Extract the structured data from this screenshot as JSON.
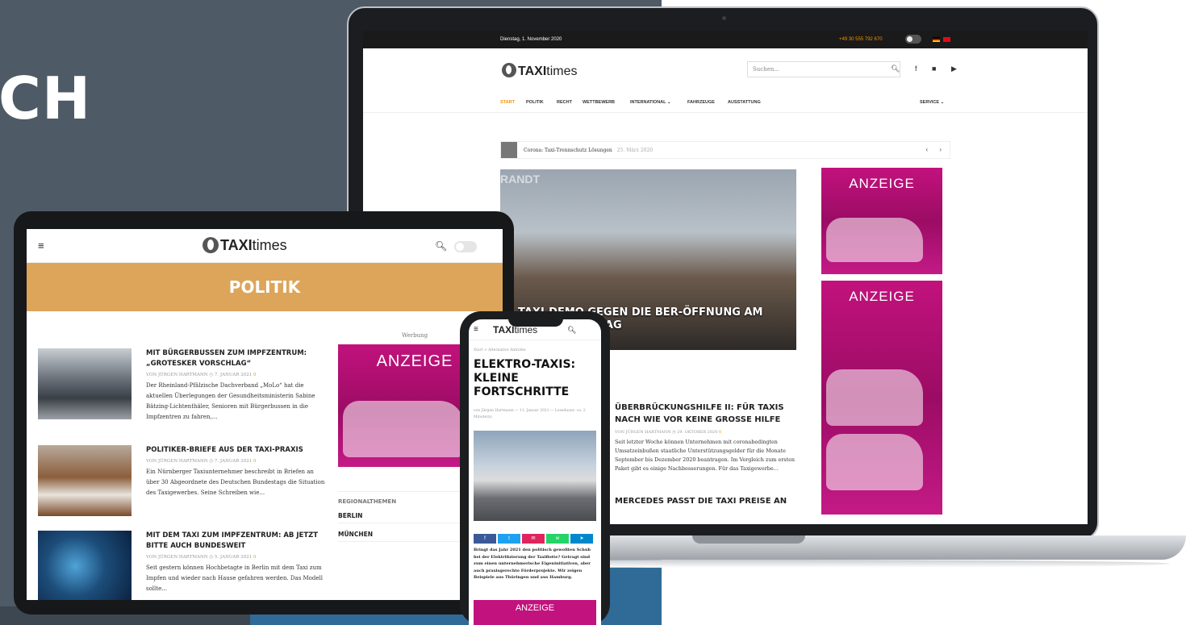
{
  "hero_headline": "CH",
  "laptop": {
    "topbar": {
      "date": "Dienstag, 1. November 2020",
      "phone": "+49 30 555 792 670"
    },
    "logo": {
      "strong": "TAXI",
      "rest": "times"
    },
    "search_placeholder": "Suchen...",
    "social_icons": "f ■ ▶",
    "nav": [
      {
        "label": "START",
        "active": true
      },
      {
        "label": "POLITIK"
      },
      {
        "label": "RECHT"
      },
      {
        "label": "WETTBEWERB"
      },
      {
        "label": "INTERNATIONAL ⌄"
      },
      {
        "label": "FAHRZEUGE"
      },
      {
        "label": "AUSSTATTUNG"
      },
      {
        "label": "SERVICE ⌄"
      }
    ],
    "ticker": {
      "text": "Corona: Taxi-Trennschutz Lösungen",
      "date": "25. März 2020"
    },
    "hero": {
      "label": "RANDT",
      "title": "TAXI-DEMO GEGEN DIE BER-ÖFFNUNG AM ERÖFFNUNGSTAG"
    },
    "ads": [
      "ANZEIGE",
      "ANZEIGE"
    ],
    "article1": {
      "title": "ÜBERBRÜCKUNGSHILFE II: FÜR TAXIS NACH WIE VOR KEINE GROSSE HILFE",
      "meta": "VON JÜRGEN HARTMANN  ◷ 29. OKTOBER 2020",
      "comments": "0",
      "excerpt": "Seit letzter Woche können Unternehmen mit coronabedingten Umsatzeinbußen staatliche Unterstützungsgelder für die Monate September bis Dezember 2020 beantragen. Im Vergleich zum ersten Paket gibt es einige Nachbesserungen. Für das Taxigewerbe..."
    },
    "article2": {
      "title": "MERCEDES PASST DIE TAXI PREISE AN"
    }
  },
  "tablet": {
    "logo": {
      "strong": "TAXI",
      "rest": "times"
    },
    "banner": "POLITIK",
    "items": [
      {
        "title": "MIT BÜRGERBUSSEN ZUM IMPFZENTRUM: „GROTESKER VORSCHLAG“",
        "meta": "VON JÜRGEN HARTMANN  ◷ 7. JANUAR 2021",
        "comments": "0",
        "excerpt": "Der Rheinland-Pfälzische Dachverband „MoLo“ hat die aktuellen Überlegungen der Gesundheitsministerin Sabine Bätzing-Lichtenthäler, Senioren mit Bürgerbussen in die Impfzentren zu fahren,..."
      },
      {
        "title": "POLITIKER-BRIEFE AUS DER TAXI-PRAXIS",
        "meta": "VON JÜRGEN HARTMANN  ◷ 7. JANUAR 2021",
        "comments": "0",
        "excerpt": "Ein Nürnberger Taxiunternehmer beschreibt in Briefen an über 30 Abgeordnete des Deutschen Bundestags die Situation des Taxigewerbes. Seine Schreiben wie..."
      },
      {
        "title": "MIT DEM TAXI ZUM IMPFZENTRUM: AB JETZT BITTE AUCH BUNDESWEIT",
        "meta": "VON JÜRGEN HARTMANN  ◷ 5. JANUAR 2021",
        "comments": "0",
        "excerpt": "Seit gestern können Hochbetagte in Berlin mit dem Taxi zum Impfen und wieder nach Hause gefahren werden. Das Modell sollte..."
      }
    ],
    "sidebar": {
      "werbung": "Werbung",
      "ad": "ANZEIGE",
      "regional": "REGIONALTHEMEN",
      "cities": [
        "BERLIN",
        "MÜNCHEN"
      ]
    }
  },
  "phone": {
    "logo": {
      "strong": "TAXI",
      "rest": "times"
    },
    "crumb": "Start > Alternative Antriebe",
    "title": "ELEKTRO-TAXIS: KLEINE FORTSCHRITTE",
    "meta": "von Jürgen Hartmann  —  11. Januar 2021  —  Lesedauer: ca. 2 Minute(n)",
    "share_colors": [
      "#3b5998",
      "#1da1f2",
      "#e0245e",
      "#25d366",
      "#0088cc"
    ],
    "body": "Bringt das Jahr 2021 den politisch gewollten Schub bei der Elektrifizierung der Taxiflotte? Getragt sind zum einen unternehmerische Eigeninitiativen, aber auch praxisgerechte Förderprojekte. Wir zeigen Beispiele aus Thüringen und aus Hamburg.",
    "ad": "ANZEIGE"
  }
}
